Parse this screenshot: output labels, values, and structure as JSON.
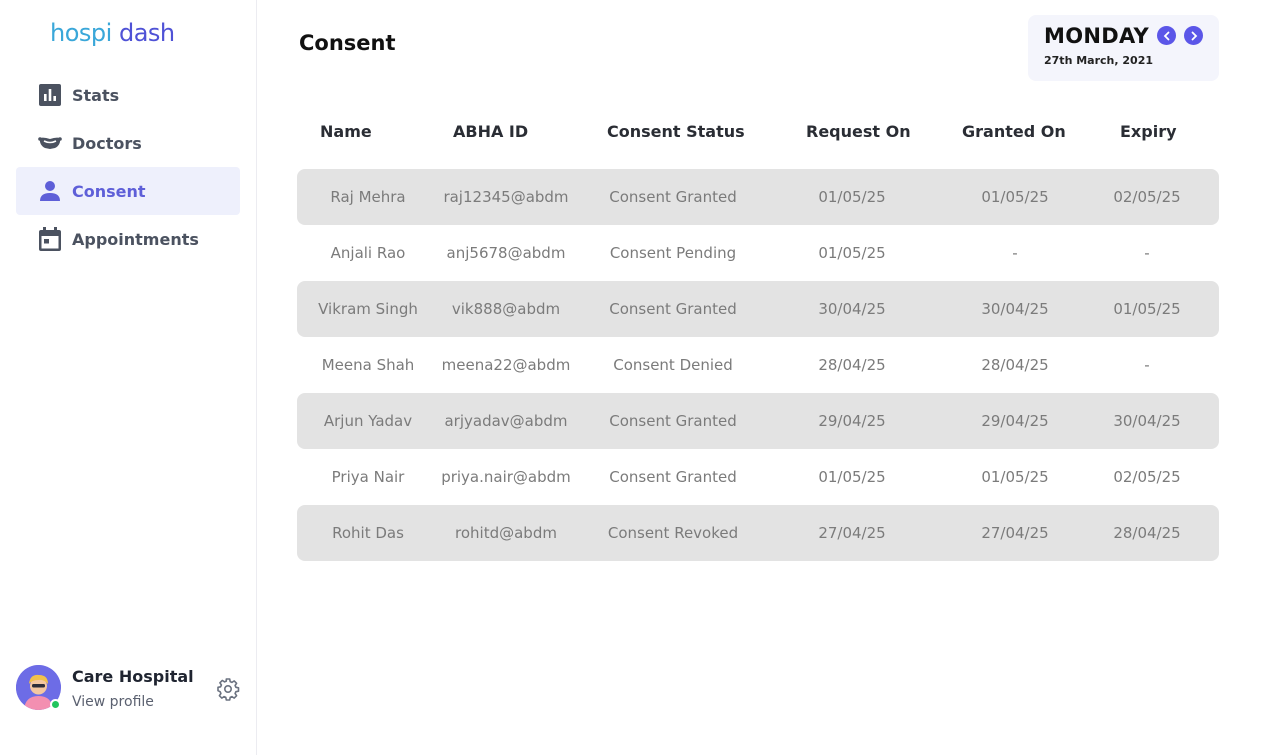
{
  "brand": {
    "part1": "hospi",
    "part2": "dash"
  },
  "sidebar": {
    "items": [
      {
        "label": "Stats",
        "icon": "bar-chart-icon"
      },
      {
        "label": "Doctors",
        "icon": "stethoscope-icon"
      },
      {
        "label": "Consent",
        "icon": "person-icon",
        "active": true
      },
      {
        "label": "Appointments",
        "icon": "calendar-icon"
      }
    ]
  },
  "profile": {
    "name": "Care Hospital",
    "link": "View profile"
  },
  "header": {
    "title": "Consent"
  },
  "date": {
    "day": "MONDAY",
    "full": "27th March, 2021"
  },
  "table": {
    "columns": [
      "Name",
      "ABHA ID",
      "Consent Status",
      "Request On",
      "Granted On",
      "Expiry"
    ],
    "rows": [
      [
        "Raj Mehra",
        "raj12345@abdm",
        "Consent Granted",
        "01/05/25",
        "01/05/25",
        "02/05/25"
      ],
      [
        "Anjali Rao",
        "anj5678@abdm",
        "Consent Pending",
        "01/05/25",
        "-",
        "-"
      ],
      [
        "Vikram Singh",
        "vik888@abdm",
        "Consent Granted",
        "30/04/25",
        "30/04/25",
        "01/05/25"
      ],
      [
        "Meena Shah",
        "meena22@abdm",
        "Consent Denied",
        "28/04/25",
        "28/04/25",
        "-"
      ],
      [
        "Arjun Yadav",
        "arjyadav@abdm",
        "Consent Granted",
        "29/04/25",
        "29/04/25",
        "30/04/25"
      ],
      [
        "Priya Nair",
        "priya.nair@abdm",
        "Consent Granted",
        "01/05/25",
        "01/05/25",
        "02/05/25"
      ],
      [
        "Rohit Das",
        "rohitd@abdm",
        "Consent Revoked",
        "27/04/25",
        "27/04/25",
        "28/04/25"
      ]
    ]
  },
  "colors": {
    "accent": "#5e5fd8",
    "active_bg": "#eef0fc",
    "row_shade": "#e3e3e3",
    "online": "#22c55e"
  }
}
